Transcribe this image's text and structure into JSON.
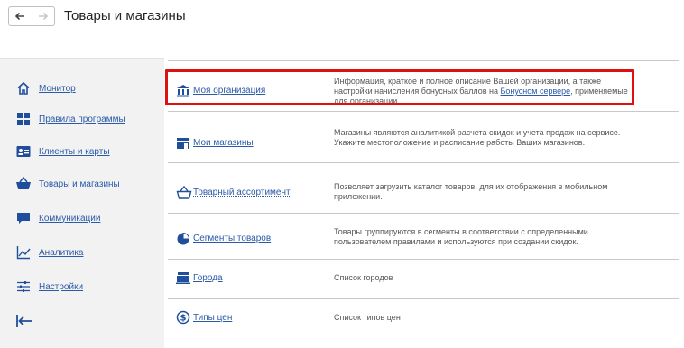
{
  "header": {
    "back_icon": "arrow-left-icon",
    "forward_icon": "arrow-right-icon",
    "title": "Товары и магазины"
  },
  "sidebar": {
    "items": [
      {
        "label": "Монитор",
        "icon": "home-icon"
      },
      {
        "label": "Правила программы",
        "icon": "grid-icon"
      },
      {
        "label": "Клиенты и карты",
        "icon": "id-card-icon"
      },
      {
        "label": "Товары и магазины",
        "icon": "shopping-basket-icon"
      },
      {
        "label": "Коммуникации",
        "icon": "chat-icon"
      },
      {
        "label": "Аналитика",
        "icon": "line-chart-icon"
      },
      {
        "label": "Настройки",
        "icon": "sliders-icon"
      }
    ],
    "exit_icon": "exit-arrow-icon"
  },
  "main": {
    "rows": [
      {
        "name": "Моя организация",
        "icon": "bank-icon",
        "desc_before": "Информация, краткое и полное описание Вашей организации, а также настройки начисления бонусных баллов на ",
        "desc_link": "Бонусном сервере",
        "desc_after": ", применяемые для организации."
      },
      {
        "name": "Мои магазины",
        "icon": "store-icon",
        "desc": "Магазины являются аналитикой расчета скидок и учета продаж на сервисе. Укажите местоположение и расписание работы Ваших магазинов."
      },
      {
        "name": "Товарный ассортимент",
        "icon": "basket-icon",
        "desc": "Позволяет загрузить каталог товаров, для их отображения в мобильном приложении."
      },
      {
        "name": "Сегменты товаров",
        "icon": "pie-chart-icon",
        "desc": "Товары группируются в сегменты в соответствии с определенными пользователем правилами и используются при создании скидок."
      },
      {
        "name": "Города",
        "icon": "city-icon",
        "desc": "Список городов"
      },
      {
        "name": "Типы цен",
        "icon": "dollar-coin-icon",
        "desc": "Список типов цен"
      }
    ]
  },
  "colors": {
    "link": "#2b5aa8",
    "icon": "#1f4e9c",
    "highlight": "#e01010",
    "sidebar_bg": "#f2f2f2"
  }
}
